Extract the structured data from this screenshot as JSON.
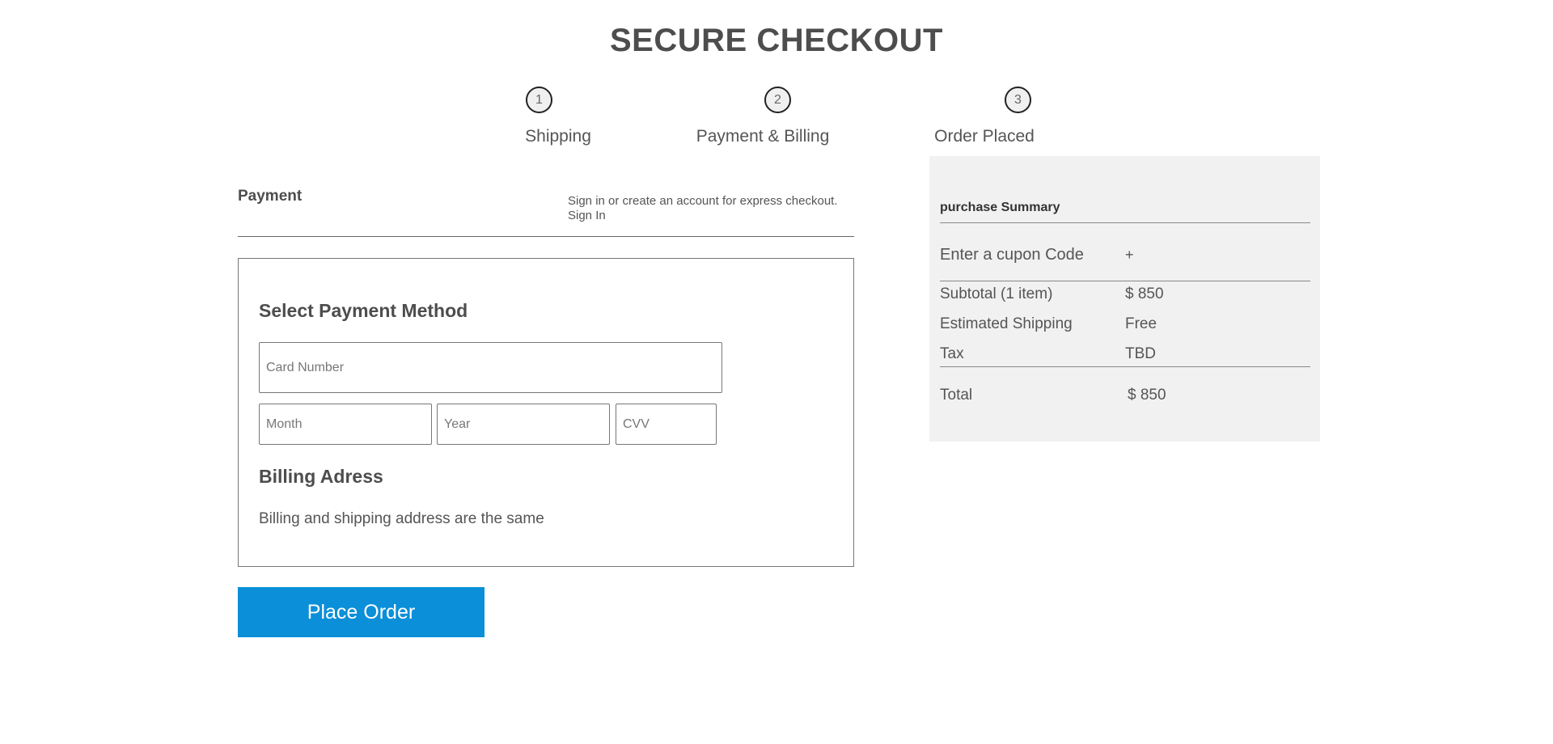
{
  "page": {
    "title": "SECURE CHECKOUT"
  },
  "steps": [
    {
      "number": "1",
      "label": "Shipping"
    },
    {
      "number": "2",
      "label": "Payment & Billing"
    },
    {
      "number": "3",
      "label": "Order Placed"
    }
  ],
  "payment": {
    "heading": "Payment",
    "signin_prompt": "Sign in or create an account for express checkout.",
    "signin_link": "Sign In"
  },
  "payment_method": {
    "title": "Select Payment Method",
    "card_number_placeholder": "Card Number",
    "month_placeholder": "Month",
    "year_placeholder": "Year",
    "cvv_placeholder": "CVV"
  },
  "billing": {
    "title": "Billing Adress",
    "text": "Billing and shipping address are the same"
  },
  "place_order_label": "Place Order",
  "summary": {
    "title": "purchase Summary",
    "coupon_label": "Enter a cupon Code",
    "coupon_add": "+",
    "rows": [
      {
        "label": "Subtotal (1 item)",
        "value": "$ 850"
      },
      {
        "label": "Estimated Shipping",
        "value": "Free"
      },
      {
        "label": "Tax",
        "value": "TBD"
      }
    ],
    "total_label": "Total",
    "total_value": "$ 850"
  },
  "colors": {
    "accent": "#0a8fd8",
    "summary_bg": "#f1f1f1",
    "text": "#555555"
  }
}
